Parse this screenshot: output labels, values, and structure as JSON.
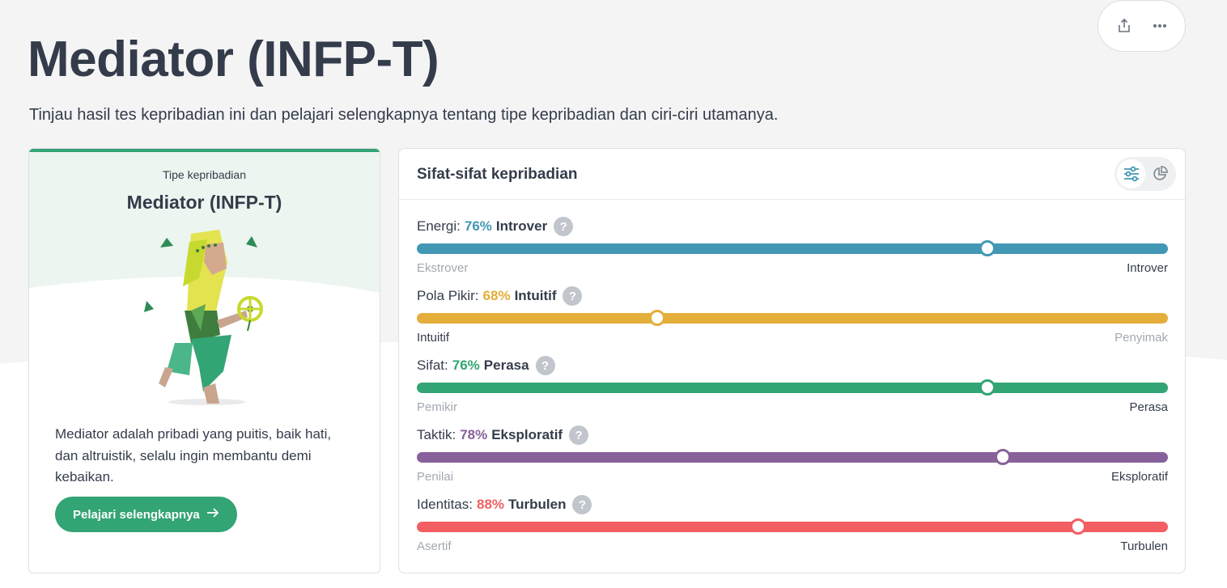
{
  "page": {
    "title": "Mediator (INFP-T)",
    "subtitle": "Tinjau hasil tes kepribadian ini dan pelajari selengkapnya tentang tipe kepribadian dan ciri-ciri utamanya."
  },
  "actions": {
    "share_icon": "share-icon",
    "more_icon": "more-icon"
  },
  "type_card": {
    "label": "Tipe kepribadian",
    "name": "Mediator (INFP-T)",
    "description": "Mediator adalah pribadi yang puitis, baik hati, dan altruistik, selalu ingin membantu demi kebaikan.",
    "button_label": "Pelajari selengkapnya",
    "accent_color": "#33a474"
  },
  "traits": {
    "title": "Sifat-sifat kepribadian",
    "items": [
      {
        "label": "Energi:",
        "percent": "76%",
        "result": "Introver",
        "left": "Ekstrover",
        "right": "Introver",
        "position": 0.76,
        "strong_side": "right",
        "color": "#4298b4"
      },
      {
        "label": "Pola Pikir:",
        "percent": "68%",
        "result": "Intuitif",
        "left": "Intuitif",
        "right": "Penyimak",
        "position": 0.32,
        "strong_side": "left",
        "color": "#e4ae3a"
      },
      {
        "label": "Sifat:",
        "percent": "76%",
        "result": "Perasa",
        "left": "Pemikir",
        "right": "Perasa",
        "position": 0.76,
        "strong_side": "right",
        "color": "#33a474"
      },
      {
        "label": "Taktik:",
        "percent": "78%",
        "result": "Eksploratif",
        "left": "Penilai",
        "right": "Eksploratif",
        "position": 0.78,
        "strong_side": "right",
        "color": "#88619a"
      },
      {
        "label": "Identitas:",
        "percent": "88%",
        "result": "Turbulen",
        "left": "Asertif",
        "right": "Turbulen",
        "position": 0.88,
        "strong_side": "right",
        "color": "#f25e62"
      }
    ]
  },
  "colors": {
    "text": "#343c4b",
    "muted": "#a3a8b1",
    "page_bg": "#f4f4f5"
  }
}
